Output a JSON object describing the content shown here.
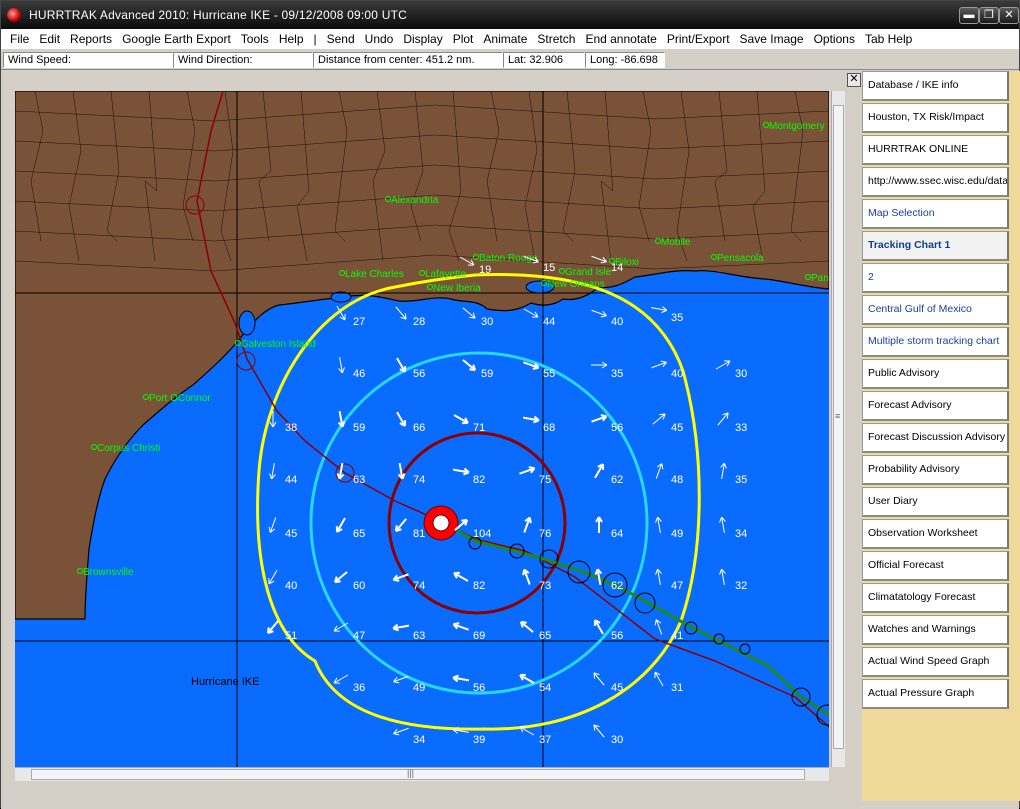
{
  "window": {
    "title": "HURRTRAK Advanced 2010: Hurricane IKE - 09/12/2008 09:00 UTC",
    "buttons": {
      "minimize": "▬",
      "maximize": "❐",
      "close": "✕"
    }
  },
  "menu": [
    {
      "label": "File"
    },
    {
      "label": "Edit"
    },
    {
      "label": "Reports"
    },
    {
      "label": "Google Earth Export"
    },
    {
      "label": "Tools"
    },
    {
      "label": "Help"
    },
    {
      "label": "|"
    },
    {
      "label": "Send"
    },
    {
      "label": "Undo"
    },
    {
      "label": "Display"
    },
    {
      "label": "Plot"
    },
    {
      "label": "Animate"
    },
    {
      "label": "Stretch"
    },
    {
      "label": "End annotate"
    },
    {
      "label": "Print/Export"
    },
    {
      "label": "Save Image"
    },
    {
      "label": "Options"
    },
    {
      "label": "Tab Help"
    }
  ],
  "status": {
    "wind_speed": "Wind Speed:",
    "wind_direction": "Wind Direction:",
    "distance": "Distance from center: 451.2 nm.",
    "lat": "Lat: 32.906",
    "long": "Long: -86.698"
  },
  "map": {
    "storm_label": "Hurricane IKE",
    "colors": {
      "water": "#0a6bff",
      "land": "#7a5238",
      "yellow_ring": "#ffff00",
      "cyan_ring": "#28d6ff",
      "red_ring": "#8b0000",
      "eye": "#ff0000",
      "forecast_track": "#1e8a1e",
      "past_track": "#8b0000",
      "place_label": "#00ff00"
    },
    "places": [
      {
        "name": "Montgomery"
      },
      {
        "name": "Alexandria"
      },
      {
        "name": "Baton Rouge"
      },
      {
        "name": "Mobile"
      },
      {
        "name": "Pensacola"
      },
      {
        "name": "Biloxi"
      },
      {
        "name": "Grand Isle"
      },
      {
        "name": "Lake Charles"
      },
      {
        "name": "Lafayette"
      },
      {
        "name": "New Iberia"
      },
      {
        "name": "New Orleans"
      },
      {
        "name": "Galveston Island"
      },
      {
        "name": "Port OConnor"
      },
      {
        "name": "Corpus Christi"
      },
      {
        "name": "Brownsville"
      },
      {
        "name": "Pan"
      }
    ],
    "wind_values": [
      {
        "v": "19"
      },
      {
        "v": "15"
      },
      {
        "v": "14"
      },
      {
        "v": "27"
      },
      {
        "v": "28"
      },
      {
        "v": "30"
      },
      {
        "v": "44"
      },
      {
        "v": "40"
      },
      {
        "v": "35"
      },
      {
        "v": "46"
      },
      {
        "v": "56"
      },
      {
        "v": "59"
      },
      {
        "v": "55"
      },
      {
        "v": "35"
      },
      {
        "v": "40"
      },
      {
        "v": "30"
      },
      {
        "v": "38"
      },
      {
        "v": "59"
      },
      {
        "v": "66"
      },
      {
        "v": "71"
      },
      {
        "v": "68"
      },
      {
        "v": "56"
      },
      {
        "v": "45"
      },
      {
        "v": "33"
      },
      {
        "v": "44"
      },
      {
        "v": "63"
      },
      {
        "v": "74"
      },
      {
        "v": "82"
      },
      {
        "v": "75"
      },
      {
        "v": "62"
      },
      {
        "v": "48"
      },
      {
        "v": "35"
      },
      {
        "v": "45"
      },
      {
        "v": "65"
      },
      {
        "v": "81"
      },
      {
        "v": "104"
      },
      {
        "v": "76"
      },
      {
        "v": "64"
      },
      {
        "v": "49"
      },
      {
        "v": "34"
      },
      {
        "v": "40"
      },
      {
        "v": "60"
      },
      {
        "v": "74"
      },
      {
        "v": "82"
      },
      {
        "v": "73"
      },
      {
        "v": "62"
      },
      {
        "v": "47"
      },
      {
        "v": "32"
      },
      {
        "v": "51"
      },
      {
        "v": "47"
      },
      {
        "v": "63"
      },
      {
        "v": "69"
      },
      {
        "v": "65"
      },
      {
        "v": "56"
      },
      {
        "v": "41"
      },
      {
        "v": "36"
      },
      {
        "v": "49"
      },
      {
        "v": "56"
      },
      {
        "v": "54"
      },
      {
        "v": "45"
      },
      {
        "v": "31"
      },
      {
        "v": "34"
      },
      {
        "v": "39"
      },
      {
        "v": "37"
      },
      {
        "v": "30"
      }
    ]
  },
  "side_tabs": [
    {
      "label": "Database / IKE info"
    },
    {
      "label": "Houston, TX Risk/Impact"
    },
    {
      "label": "HURRTRAK ONLINE"
    },
    {
      "label": "http://www.ssec.wisc.edu/data/g"
    },
    {
      "label": "Map Selection"
    },
    {
      "label": "Tracking Chart 1"
    },
    {
      "label": "2"
    },
    {
      "label": "Central Gulf of Mexico"
    },
    {
      "label": "Multiple storm tracking chart"
    },
    {
      "label": "Public Advisory"
    },
    {
      "label": "Forecast Advisory"
    },
    {
      "label": "Forecast Discussion Advisory"
    },
    {
      "label": "Probability Advisory"
    },
    {
      "label": "User Diary"
    },
    {
      "label": "Observation Worksheet"
    },
    {
      "label": "Official Forecast"
    },
    {
      "label": "Climatatology Forecast"
    },
    {
      "label": "Watches and Warnings"
    },
    {
      "label": "Actual Wind Speed Graph"
    },
    {
      "label": "Actual Pressure Graph"
    }
  ]
}
